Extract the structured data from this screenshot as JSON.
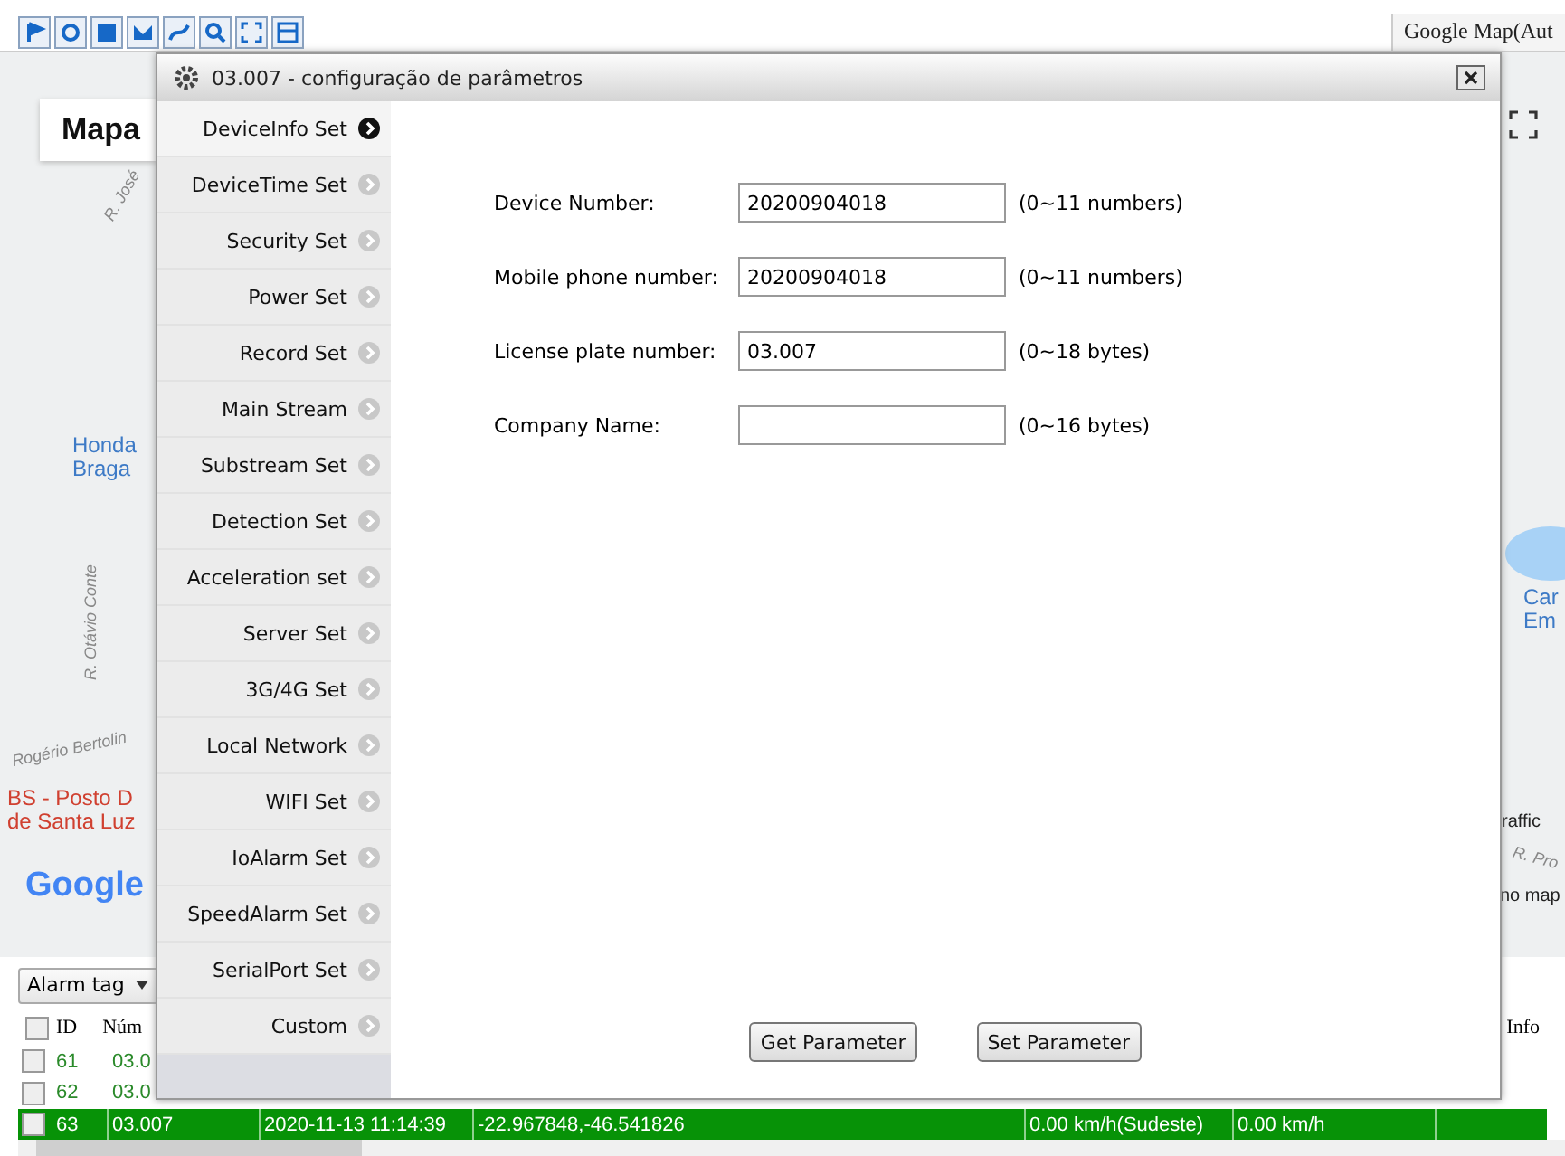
{
  "map_tab": "Google Map(Aut",
  "map": {
    "button": "Mapa",
    "labels": [
      {
        "kind": "street",
        "text": "R. José"
      },
      {
        "kind": "poi",
        "text": "Honda"
      },
      {
        "kind": "poi",
        "text": "Braga"
      },
      {
        "kind": "street",
        "text": "R. Otávio Conte"
      },
      {
        "kind": "street",
        "text": "Rogério Bertolin"
      },
      {
        "kind": "place",
        "text": "BS - Posto D"
      },
      {
        "kind": "place",
        "text": "de Santa Luz"
      },
      {
        "kind": "poi",
        "text": "Car"
      },
      {
        "kind": "poi",
        "text": "Em"
      },
      {
        "kind": "plain",
        "text": "raffic"
      },
      {
        "kind": "street",
        "text": "R. Pro"
      },
      {
        "kind": "plain",
        "text": "no map"
      }
    ],
    "logo": "Google"
  },
  "dialog": {
    "title": "03.007 - configuração de parâmetros",
    "menu": [
      {
        "label": "DeviceInfo Set",
        "selected": true
      },
      {
        "label": "DeviceTime Set",
        "selected": false
      },
      {
        "label": "Security Set",
        "selected": false
      },
      {
        "label": "Power Set",
        "selected": false
      },
      {
        "label": "Record Set",
        "selected": false
      },
      {
        "label": "Main Stream",
        "selected": false
      },
      {
        "label": "Substream Set",
        "selected": false
      },
      {
        "label": "Detection Set",
        "selected": false
      },
      {
        "label": "Acceleration set",
        "selected": false
      },
      {
        "label": "Server Set",
        "selected": false
      },
      {
        "label": "3G/4G Set",
        "selected": false
      },
      {
        "label": "Local Network",
        "selected": false
      },
      {
        "label": "WIFI Set",
        "selected": false
      },
      {
        "label": "IoAlarm Set",
        "selected": false
      },
      {
        "label": "SpeedAlarm Set",
        "selected": false
      },
      {
        "label": "SerialPort Set",
        "selected": false
      },
      {
        "label": "Custom",
        "selected": false
      }
    ],
    "fields": [
      {
        "label": "Device Number:",
        "value": "20200904018",
        "hint": "(0~11 numbers)"
      },
      {
        "label": "Mobile phone number:",
        "value": "20200904018",
        "hint": "(0~11 numbers)"
      },
      {
        "label": "License plate number:",
        "value": "03.007",
        "hint": "(0~18 bytes)"
      },
      {
        "label": "Company Name:",
        "hint": "(0~16 bytes)"
      }
    ],
    "buttons": [
      "Get Parameter",
      "Set Parameter"
    ]
  },
  "alarm_tag": "Alarm tag",
  "table": {
    "columns": [
      "ID",
      "Núm",
      "Info"
    ],
    "all_checked": false,
    "rows": [
      {
        "checked": false,
        "selected": false,
        "cells": [
          "61",
          "03.0"
        ]
      },
      {
        "checked": false,
        "selected": false,
        "cells": [
          "62",
          "03.0"
        ]
      },
      {
        "checked": false,
        "selected": true,
        "cells": [
          "63",
          "03.007",
          "2020-11-13 11:14:39",
          "-22.967848,-46.541826",
          "0.00 km/h(Sudeste)",
          "0.00 km/h"
        ]
      }
    ]
  }
}
